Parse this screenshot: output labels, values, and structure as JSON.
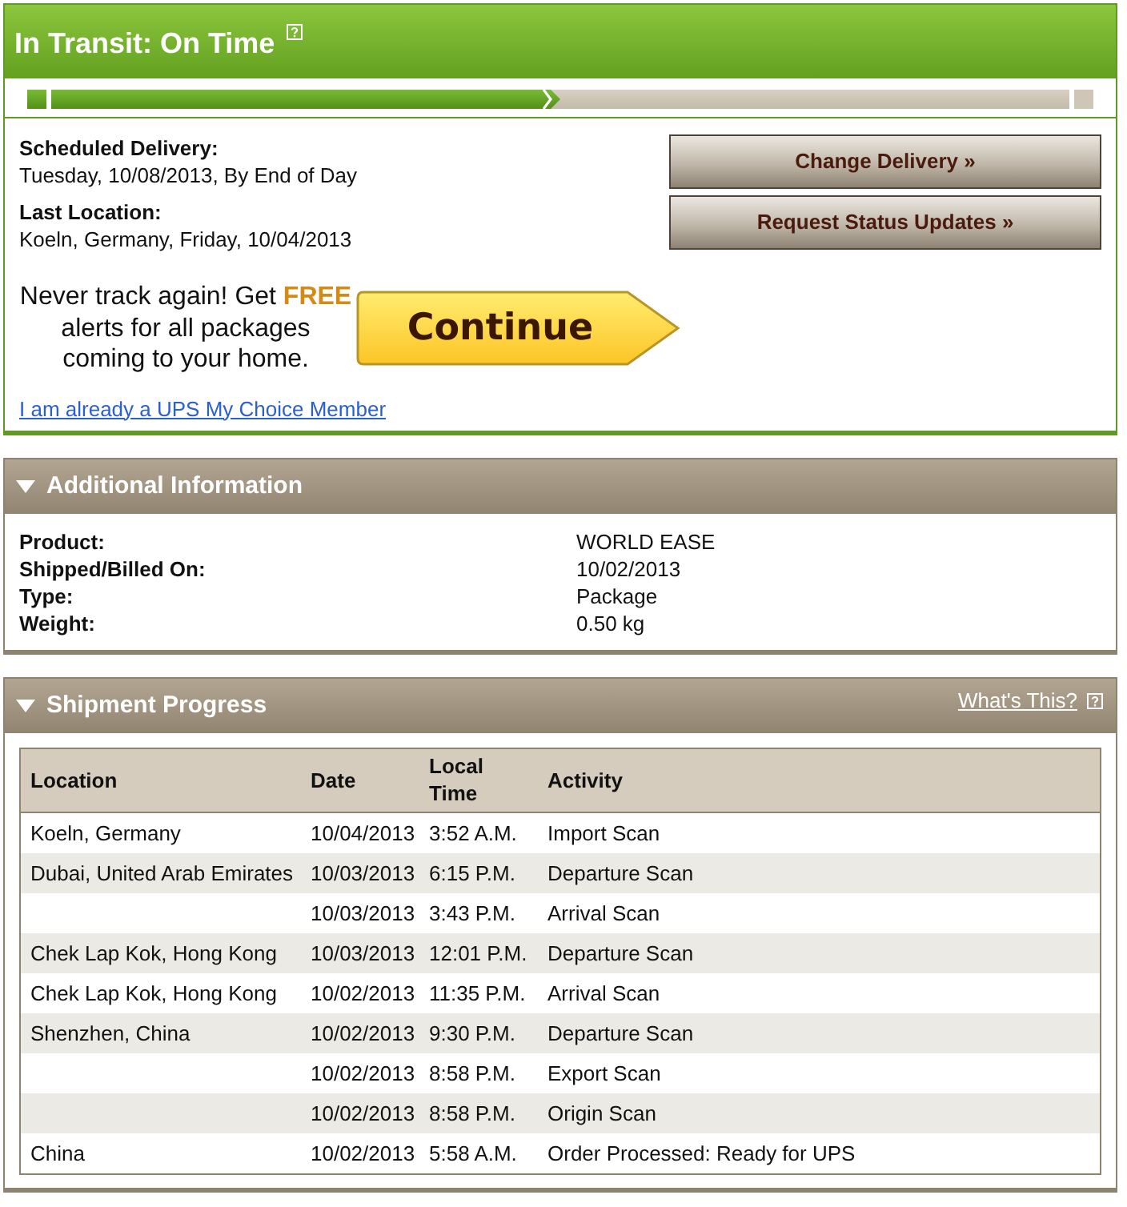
{
  "status": {
    "title": "In Transit: On Time",
    "progress": {
      "level": 0.5
    }
  },
  "delivery": {
    "fields": [
      {
        "label": "Scheduled Delivery:",
        "value": "Tuesday, 10/08/2013, By End of Day"
      },
      {
        "label": "Last Location:",
        "value": "Koeln, Germany, Friday, 10/04/2013"
      }
    ],
    "buttons": [
      {
        "label": "Change Delivery »"
      },
      {
        "label": "Request Status Updates »"
      }
    ]
  },
  "promo": {
    "text": "Never track again! Get **FREE** alerts for all packages coming to your home.",
    "button": "Continue",
    "link": "I am already a UPS My Choice Member"
  },
  "additional_information": {
    "title": "Additional Information",
    "expanded": true,
    "rows": [
      {
        "label": "Product:",
        "value": "WORLD EASE"
      },
      {
        "label": "Shipped/Billed On:",
        "value": "10/02/2013"
      },
      {
        "label": "Type:",
        "value": "Package"
      },
      {
        "label": "Weight:",
        "value": "0.50 kg"
      }
    ]
  },
  "shipment_progress": {
    "title": "Shipment Progress",
    "expanded": true,
    "help_link": "What's This?",
    "columns": [
      "Location",
      "Date",
      "Local Time",
      "Activity"
    ],
    "rows": [
      {
        "location": "Koeln, Germany",
        "date": "10/04/2013",
        "time": "3:52 A.M.",
        "activity": "Import Scan"
      },
      {
        "location": "Dubai, United Arab Emirates",
        "date": "10/03/2013",
        "time": "6:15 P.M.",
        "activity": "Departure Scan"
      },
      {
        "date": "10/03/2013",
        "time": "3:43 P.M.",
        "activity": "Arrival Scan"
      },
      {
        "location": "Chek Lap Kok, Hong Kong",
        "date": "10/03/2013",
        "time": "12:01 P.M.",
        "activity": "Departure Scan"
      },
      {
        "location": "Chek Lap Kok, Hong Kong",
        "date": "10/02/2013",
        "time": "11:35 P.M.",
        "activity": "Arrival Scan"
      },
      {
        "location": "Shenzhen, China",
        "date": "10/02/2013",
        "time": "9:30 P.M.",
        "activity": "Departure Scan"
      },
      {
        "date": "10/02/2013",
        "time": "8:58 P.M.",
        "activity": "Export Scan"
      },
      {
        "date": "10/02/2013",
        "time": "8:58 P.M.",
        "activity": "Origin Scan"
      },
      {
        "location": "China",
        "date": "10/02/2013",
        "time": "5:58 A.M.",
        "activity": "Order Processed: Ready for UPS"
      }
    ]
  }
}
